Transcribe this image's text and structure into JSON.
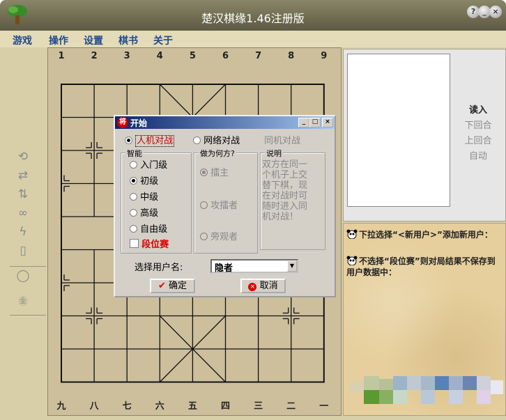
{
  "window": {
    "title": "楚汉棋缘1.46注册版",
    "buttons": [
      "?",
      "_",
      "×"
    ]
  },
  "menu": {
    "items": [
      "游戏",
      "操作",
      "设置",
      "棋书",
      "关于"
    ]
  },
  "board": {
    "top_files": [
      "1",
      "2",
      "3",
      "4",
      "5",
      "6",
      "7",
      "8",
      "9"
    ],
    "bottom_files": [
      "九",
      "八",
      "七",
      "六",
      "五",
      "四",
      "三",
      "二",
      "一"
    ]
  },
  "right_panel": {
    "buttons": [
      "读入",
      "下回合",
      "上回合",
      "自动"
    ]
  },
  "messages": [
    "下拉选择“<新用户>”添加新用户：",
    "不选择“段位赛”则对局结果不保存到用户数据中："
  ],
  "dialog": {
    "title": "开始",
    "icon_text": "将",
    "modes": [
      {
        "label": "人机对战",
        "selected": true
      },
      {
        "label": "网络对战",
        "selected": false
      },
      {
        "label": "同机对战",
        "disabled": true
      }
    ],
    "ai_group": {
      "label": "智能",
      "options": [
        {
          "label": "入门级",
          "selected": false
        },
        {
          "label": "初级",
          "selected": true
        },
        {
          "label": "中级",
          "selected": false
        },
        {
          "label": "高级",
          "selected": false
        },
        {
          "label": "自由级",
          "selected": false
        }
      ],
      "rank_label": "段位赛"
    },
    "role_group": {
      "label": "做为何方?",
      "options": [
        {
          "label": "擂主",
          "selected": true
        },
        {
          "label": "攻擂者",
          "selected": false
        },
        {
          "label": "旁观者",
          "selected": false
        }
      ]
    },
    "desc_group": {
      "label": "说明",
      "text": "双方在同一个机子上交替下棋，现在对战时可随时进入同机对战！"
    },
    "user_label": "选择用户名:",
    "user_value": "隐者",
    "ok_label": "确定",
    "cancel_label": "取消"
  },
  "colors": {
    "board_bg": "#cdbf9c",
    "accent_blue": "#214a8c",
    "rank_red": "#dd0000"
  }
}
